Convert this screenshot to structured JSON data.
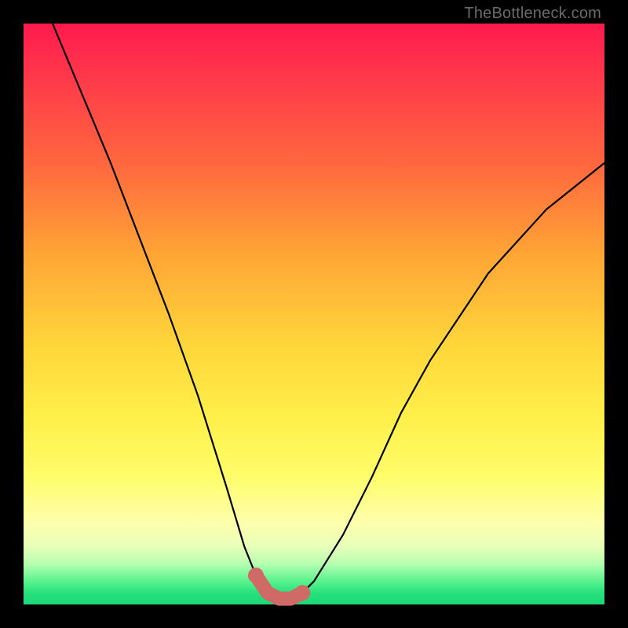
{
  "watermark": "TheBottleneck.com",
  "chart_data": {
    "type": "line",
    "title": "",
    "xlabel": "",
    "ylabel": "",
    "xlim": [
      0,
      100
    ],
    "ylim": [
      0,
      100
    ],
    "grid": false,
    "series": [
      {
        "name": "bottleneck-curve",
        "x": [
          5,
          10,
          15,
          20,
          25,
          30,
          35,
          38,
          40,
          42,
          44,
          46,
          48,
          50,
          55,
          60,
          65,
          70,
          80,
          90,
          100
        ],
        "y": [
          100,
          88,
          76,
          63,
          50,
          36,
          20,
          10,
          5,
          2,
          1,
          1,
          2,
          4,
          12,
          22,
          33,
          42,
          57,
          68,
          76
        ]
      }
    ],
    "annotations": [
      {
        "name": "flat-bottom-highlight",
        "kind": "thick-segment",
        "x": [
          40,
          42,
          44,
          46,
          48
        ],
        "y": [
          5,
          2,
          1,
          1,
          2
        ]
      }
    ],
    "colors": {
      "curve": "#000000",
      "highlight": "#cf6a67",
      "gradient_top": "#ff1a4d",
      "gradient_mid": "#ffe64a",
      "gradient_bottom": "#1ed877"
    }
  }
}
